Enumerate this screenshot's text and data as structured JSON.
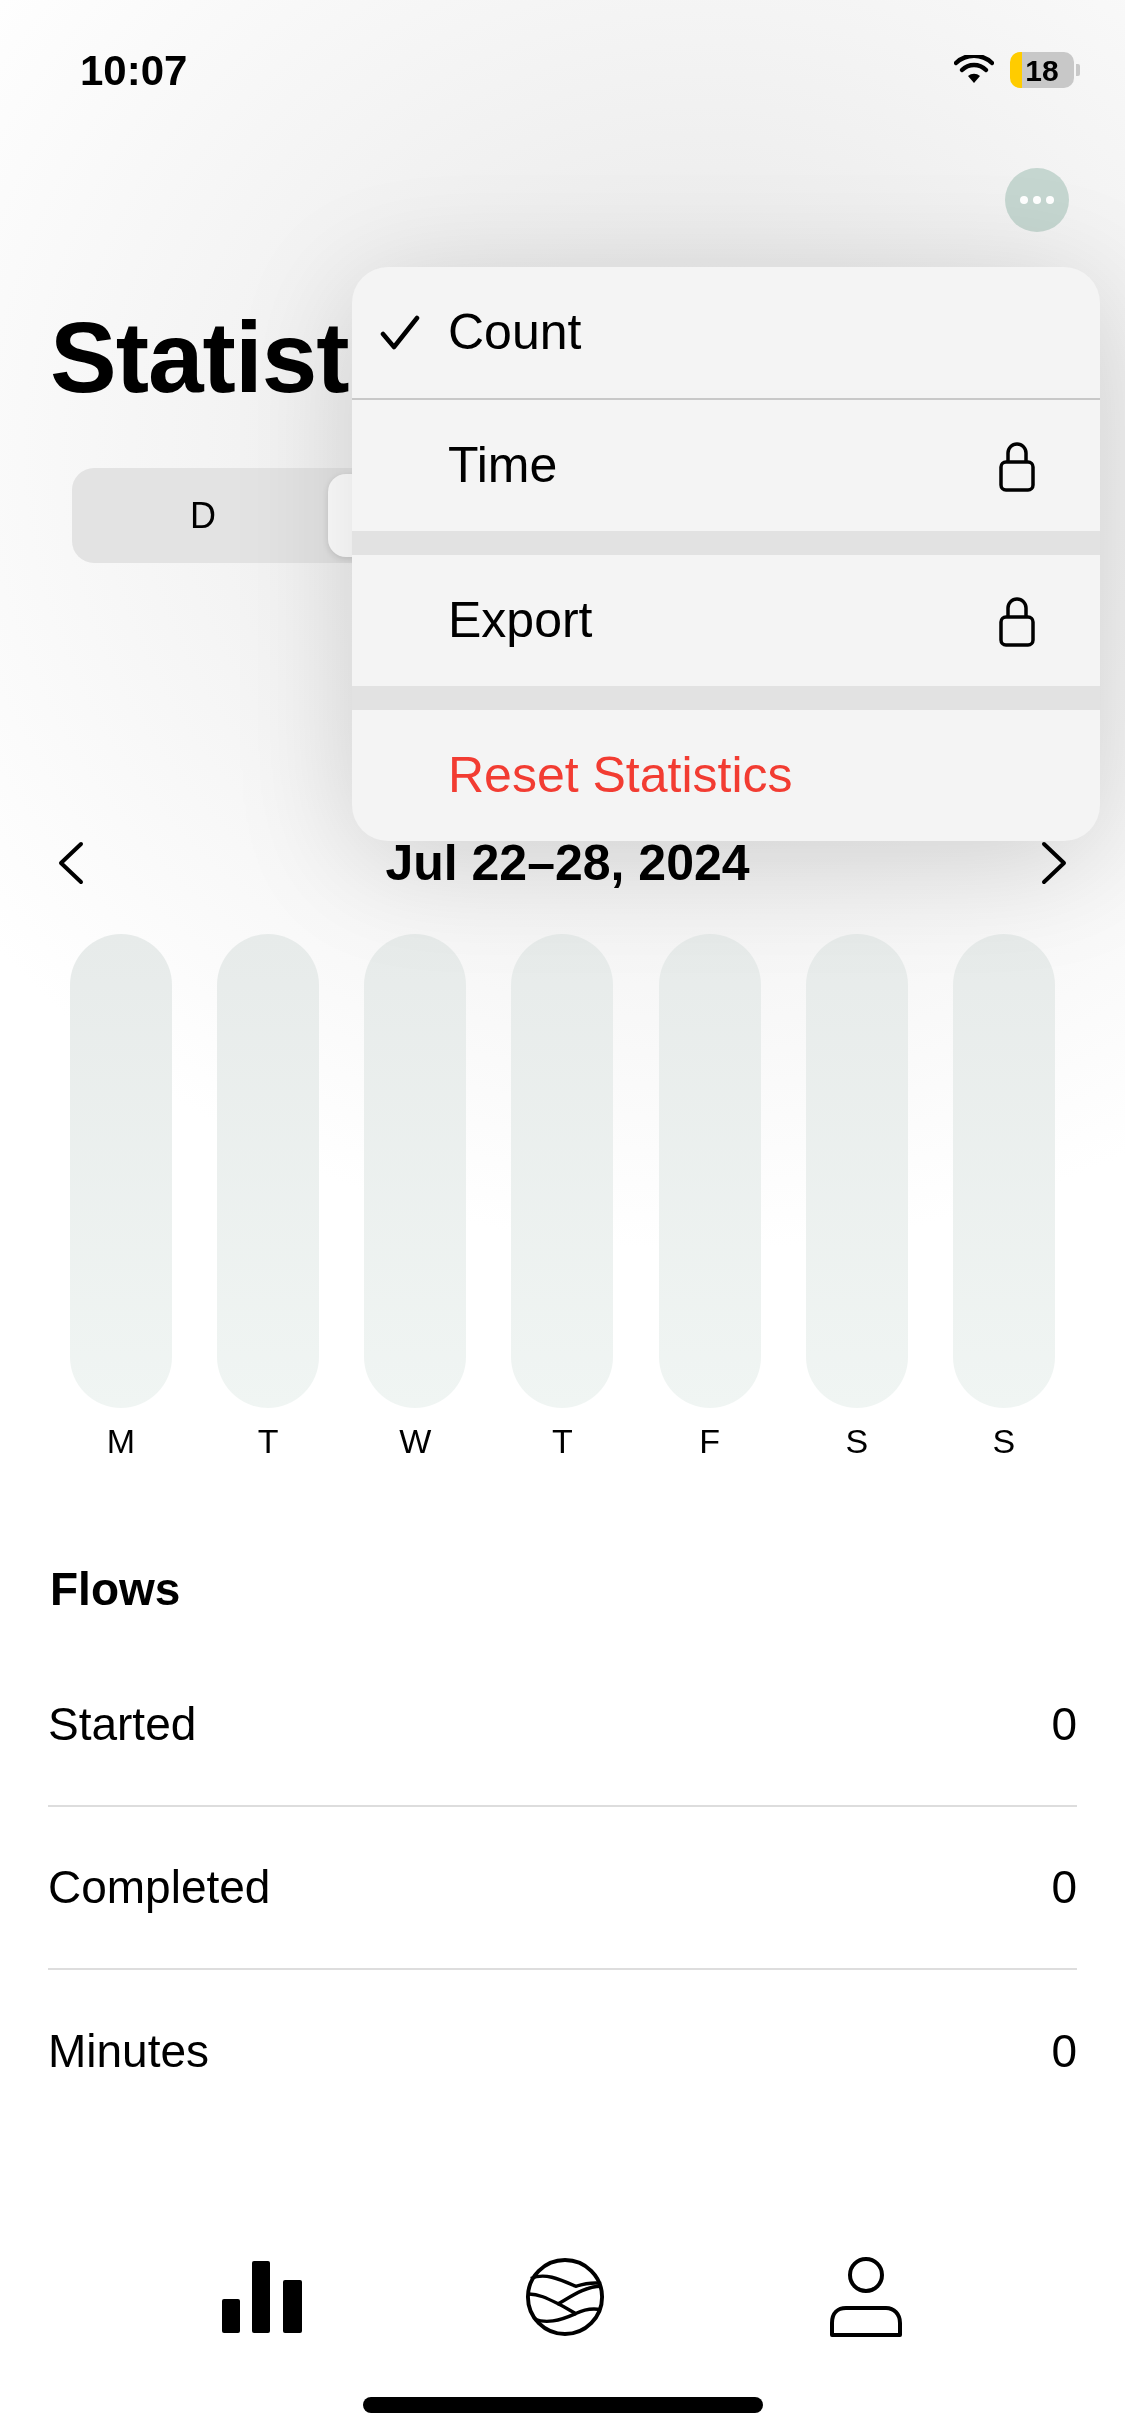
{
  "status_bar": {
    "time": "10:07",
    "battery": "18"
  },
  "title": "Statist",
  "segmented_control": {
    "segments": [
      {
        "label": "D",
        "selected": false
      },
      {
        "selected": true
      }
    ]
  },
  "menu": {
    "items": [
      {
        "label": "Count",
        "kind": "option",
        "checked": true,
        "locked": false
      },
      {
        "label": "Time",
        "kind": "option",
        "checked": false,
        "locked": true
      },
      {
        "label": "Export",
        "kind": "action",
        "locked": true
      },
      {
        "label": "Reset Statistics",
        "kind": "destructive",
        "locked": false
      }
    ]
  },
  "date_range": "Jul 22–28, 2024",
  "chart": {
    "days": [
      "M",
      "T",
      "W",
      "T",
      "F",
      "S",
      "S"
    ]
  },
  "flows": {
    "title": "Flows",
    "rows": [
      {
        "label": "Started",
        "value": "0"
      },
      {
        "label": "Completed",
        "value": "0"
      },
      {
        "label": "Minutes",
        "value": "0"
      }
    ]
  }
}
